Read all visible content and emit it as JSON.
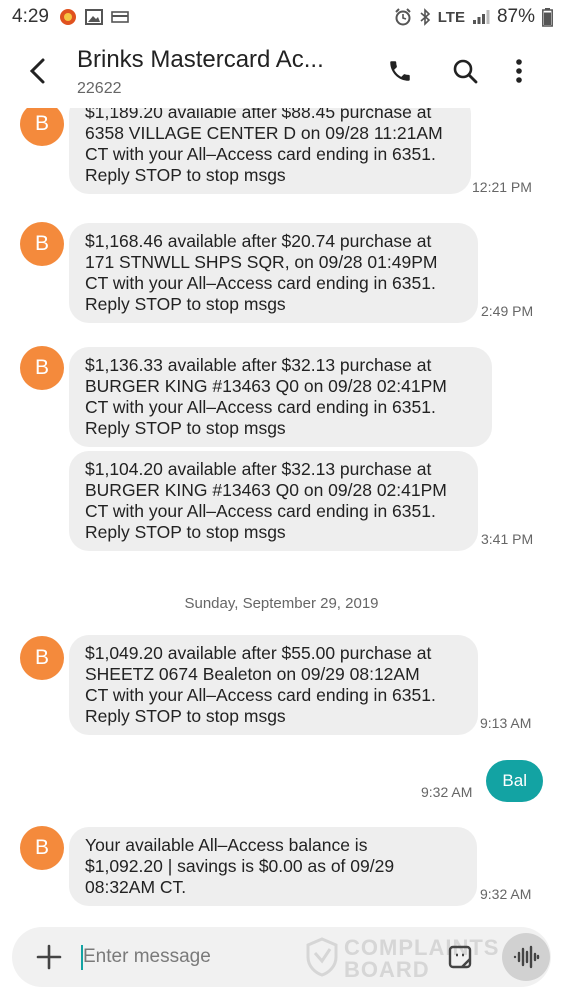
{
  "status_bar": {
    "time": "4:29",
    "network": "LTE",
    "battery": "87%"
  },
  "header": {
    "title": "Brinks Mastercard Ac...",
    "number": "22622"
  },
  "messages": [
    {
      "avatar": "B",
      "lines": [
        "$1,189.20 available after $88.45 purchase at",
        "6358 VILLAGE CENTER D on 09/28 11:21AM",
        "CT with your All–Access card ending in 6351.",
        "Reply STOP to stop msgs"
      ],
      "time": "12:21 PM"
    },
    {
      "avatar": "B",
      "lines": [
        "$1,168.46 available after $20.74 purchase at",
        "171 STNWLL SHPS SQR, on 09/28 01:49PM",
        "CT with your All–Access card ending in 6351.",
        "Reply STOP to stop msgs"
      ],
      "time": "2:49 PM"
    },
    {
      "avatar": "B",
      "lines": [
        "$1,136.33 available after $32.13 purchase at",
        "BURGER KING #13463 Q0 on 09/28 02:41PM",
        "CT with your All–Access card ending in 6351.",
        "Reply STOP to stop msgs"
      ],
      "time": ""
    },
    {
      "avatar": "",
      "lines": [
        "$1,104.20 available after $32.13 purchase at",
        "BURGER KING #13463 Q0 on 09/28 02:41PM",
        "CT with your All–Access card ending in 6351.",
        "Reply STOP to stop msgs"
      ],
      "time": "3:41 PM"
    },
    {
      "avatar": "B",
      "lines": [
        "$1,049.20 available after $55.00 purchase at",
        "SHEETZ 0674 Bealeton on 09/29 08:12AM",
        "CT with your All–Access card ending in 6351.",
        "Reply STOP to stop msgs"
      ],
      "time": "9:13 AM"
    },
    {
      "avatar": "B",
      "lines": [
        "Your available All–Access balance is",
        "$1,092.20 | savings is $0.00 as of 09/29",
        "08:32AM CT."
      ],
      "time": "9:32 AM"
    }
  ],
  "date_separator": "Sunday, September 29, 2019",
  "outgoing": {
    "text": "Bal",
    "time": "9:32 AM"
  },
  "input": {
    "placeholder": "Enter message"
  },
  "watermark": {
    "line1": "COMPLAINTS",
    "line2": "BOARD"
  },
  "colors": {
    "avatar": "#f48a3c",
    "outgoing_bubble": "#13a3a3",
    "incoming_bubble": "#eeeeee"
  },
  "icons": [
    "back-arrow-icon",
    "phone-icon",
    "search-icon",
    "more-vert-icon",
    "plus-icon",
    "sticker-icon",
    "voice-wave-icon"
  ]
}
